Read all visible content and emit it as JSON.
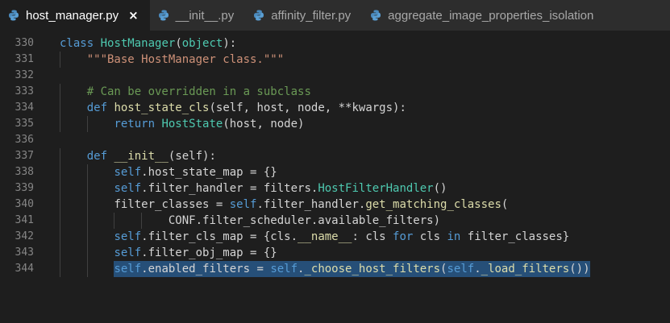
{
  "tabs": [
    {
      "label": "host_manager.py",
      "active": true,
      "icon": "python-icon",
      "close": "×"
    },
    {
      "label": "__init__.py",
      "active": false,
      "icon": "python-icon"
    },
    {
      "label": "affinity_filter.py",
      "active": false,
      "icon": "python-icon"
    },
    {
      "label": "aggregate_image_properties_isolation",
      "active": false,
      "icon": "python-icon"
    }
  ],
  "editor": {
    "lines": [
      {
        "no": "330",
        "indent": 0,
        "tokens": [
          {
            "t": "class",
            "c": "kw"
          },
          {
            "t": " "
          },
          {
            "t": "HostManager",
            "c": "cls"
          },
          {
            "t": "("
          },
          {
            "t": "object",
            "c": "cls"
          },
          {
            "t": "):"
          }
        ]
      },
      {
        "no": "331",
        "indent": 1,
        "tokens": [
          {
            "t": "\"\"\"Base HostManager class.\"\"\"",
            "c": "str"
          }
        ]
      },
      {
        "no": "332",
        "indent": 0,
        "tokens": []
      },
      {
        "no": "333",
        "indent": 1,
        "tokens": [
          {
            "t": "# Can be overridden in a subclass",
            "c": "cm"
          }
        ]
      },
      {
        "no": "334",
        "indent": 1,
        "tokens": [
          {
            "t": "def",
            "c": "kw"
          },
          {
            "t": " "
          },
          {
            "t": "host_state_cls",
            "c": "fn"
          },
          {
            "t": "(self, host, node, **kwargs):"
          }
        ]
      },
      {
        "no": "335",
        "indent": 2,
        "tokens": [
          {
            "t": "return",
            "c": "kw"
          },
          {
            "t": " "
          },
          {
            "t": "HostState",
            "c": "cls"
          },
          {
            "t": "(host, node)"
          }
        ]
      },
      {
        "no": "336",
        "indent": 0,
        "tokens": []
      },
      {
        "no": "337",
        "indent": 1,
        "tokens": [
          {
            "t": "def",
            "c": "kw"
          },
          {
            "t": " "
          },
          {
            "t": "__init__",
            "c": "fn"
          },
          {
            "t": "(self):"
          }
        ]
      },
      {
        "no": "338",
        "indent": 2,
        "tokens": [
          {
            "t": "self",
            "c": "selfk"
          },
          {
            "t": ".host_state_map = {}"
          }
        ]
      },
      {
        "no": "339",
        "indent": 2,
        "tokens": [
          {
            "t": "self",
            "c": "selfk"
          },
          {
            "t": ".filter_handler = filters."
          },
          {
            "t": "HostFilterHandler",
            "c": "cls"
          },
          {
            "t": "()"
          }
        ]
      },
      {
        "no": "340",
        "indent": 2,
        "tokens": [
          {
            "t": "filter_classes = "
          },
          {
            "t": "self",
            "c": "selfk"
          },
          {
            "t": ".filter_handler."
          },
          {
            "t": "get_matching_classes",
            "c": "fn"
          },
          {
            "t": "("
          }
        ]
      },
      {
        "no": "341",
        "indent": 4,
        "tokens": [
          {
            "t": "CONF.filter_scheduler.available_filters)"
          }
        ]
      },
      {
        "no": "342",
        "indent": 2,
        "tokens": [
          {
            "t": "self",
            "c": "selfk"
          },
          {
            "t": ".filter_cls_map = {cls."
          },
          {
            "t": "__name__",
            "c": "fn"
          },
          {
            "t": ": cls "
          },
          {
            "t": "for",
            "c": "kw"
          },
          {
            "t": " cls "
          },
          {
            "t": "in",
            "c": "kw"
          },
          {
            "t": " filter_classes}"
          }
        ]
      },
      {
        "no": "343",
        "indent": 2,
        "tokens": [
          {
            "t": "self",
            "c": "selfk"
          },
          {
            "t": ".filter_obj_map = {}"
          }
        ]
      },
      {
        "no": "344",
        "indent": 2,
        "selected": true,
        "tokens": [
          {
            "t": "self",
            "c": "selfk"
          },
          {
            "t": ".enabled_filters = "
          },
          {
            "t": "self",
            "c": "selfk"
          },
          {
            "t": "."
          },
          {
            "t": "_choose_host_filters",
            "c": "fn"
          },
          {
            "t": "("
          },
          {
            "t": "self",
            "c": "selfk"
          },
          {
            "t": "."
          },
          {
            "t": "_load_filters",
            "c": "fn"
          },
          {
            "t": "())"
          }
        ]
      }
    ]
  },
  "colors": {
    "background": "#1e1e1e",
    "tabbar": "#2d2d2d",
    "keyword": "#569cd6",
    "function": "#dcdcaa",
    "class": "#4ec9b0",
    "string": "#ce9178",
    "comment": "#6a9955",
    "selection": "#264f78"
  }
}
